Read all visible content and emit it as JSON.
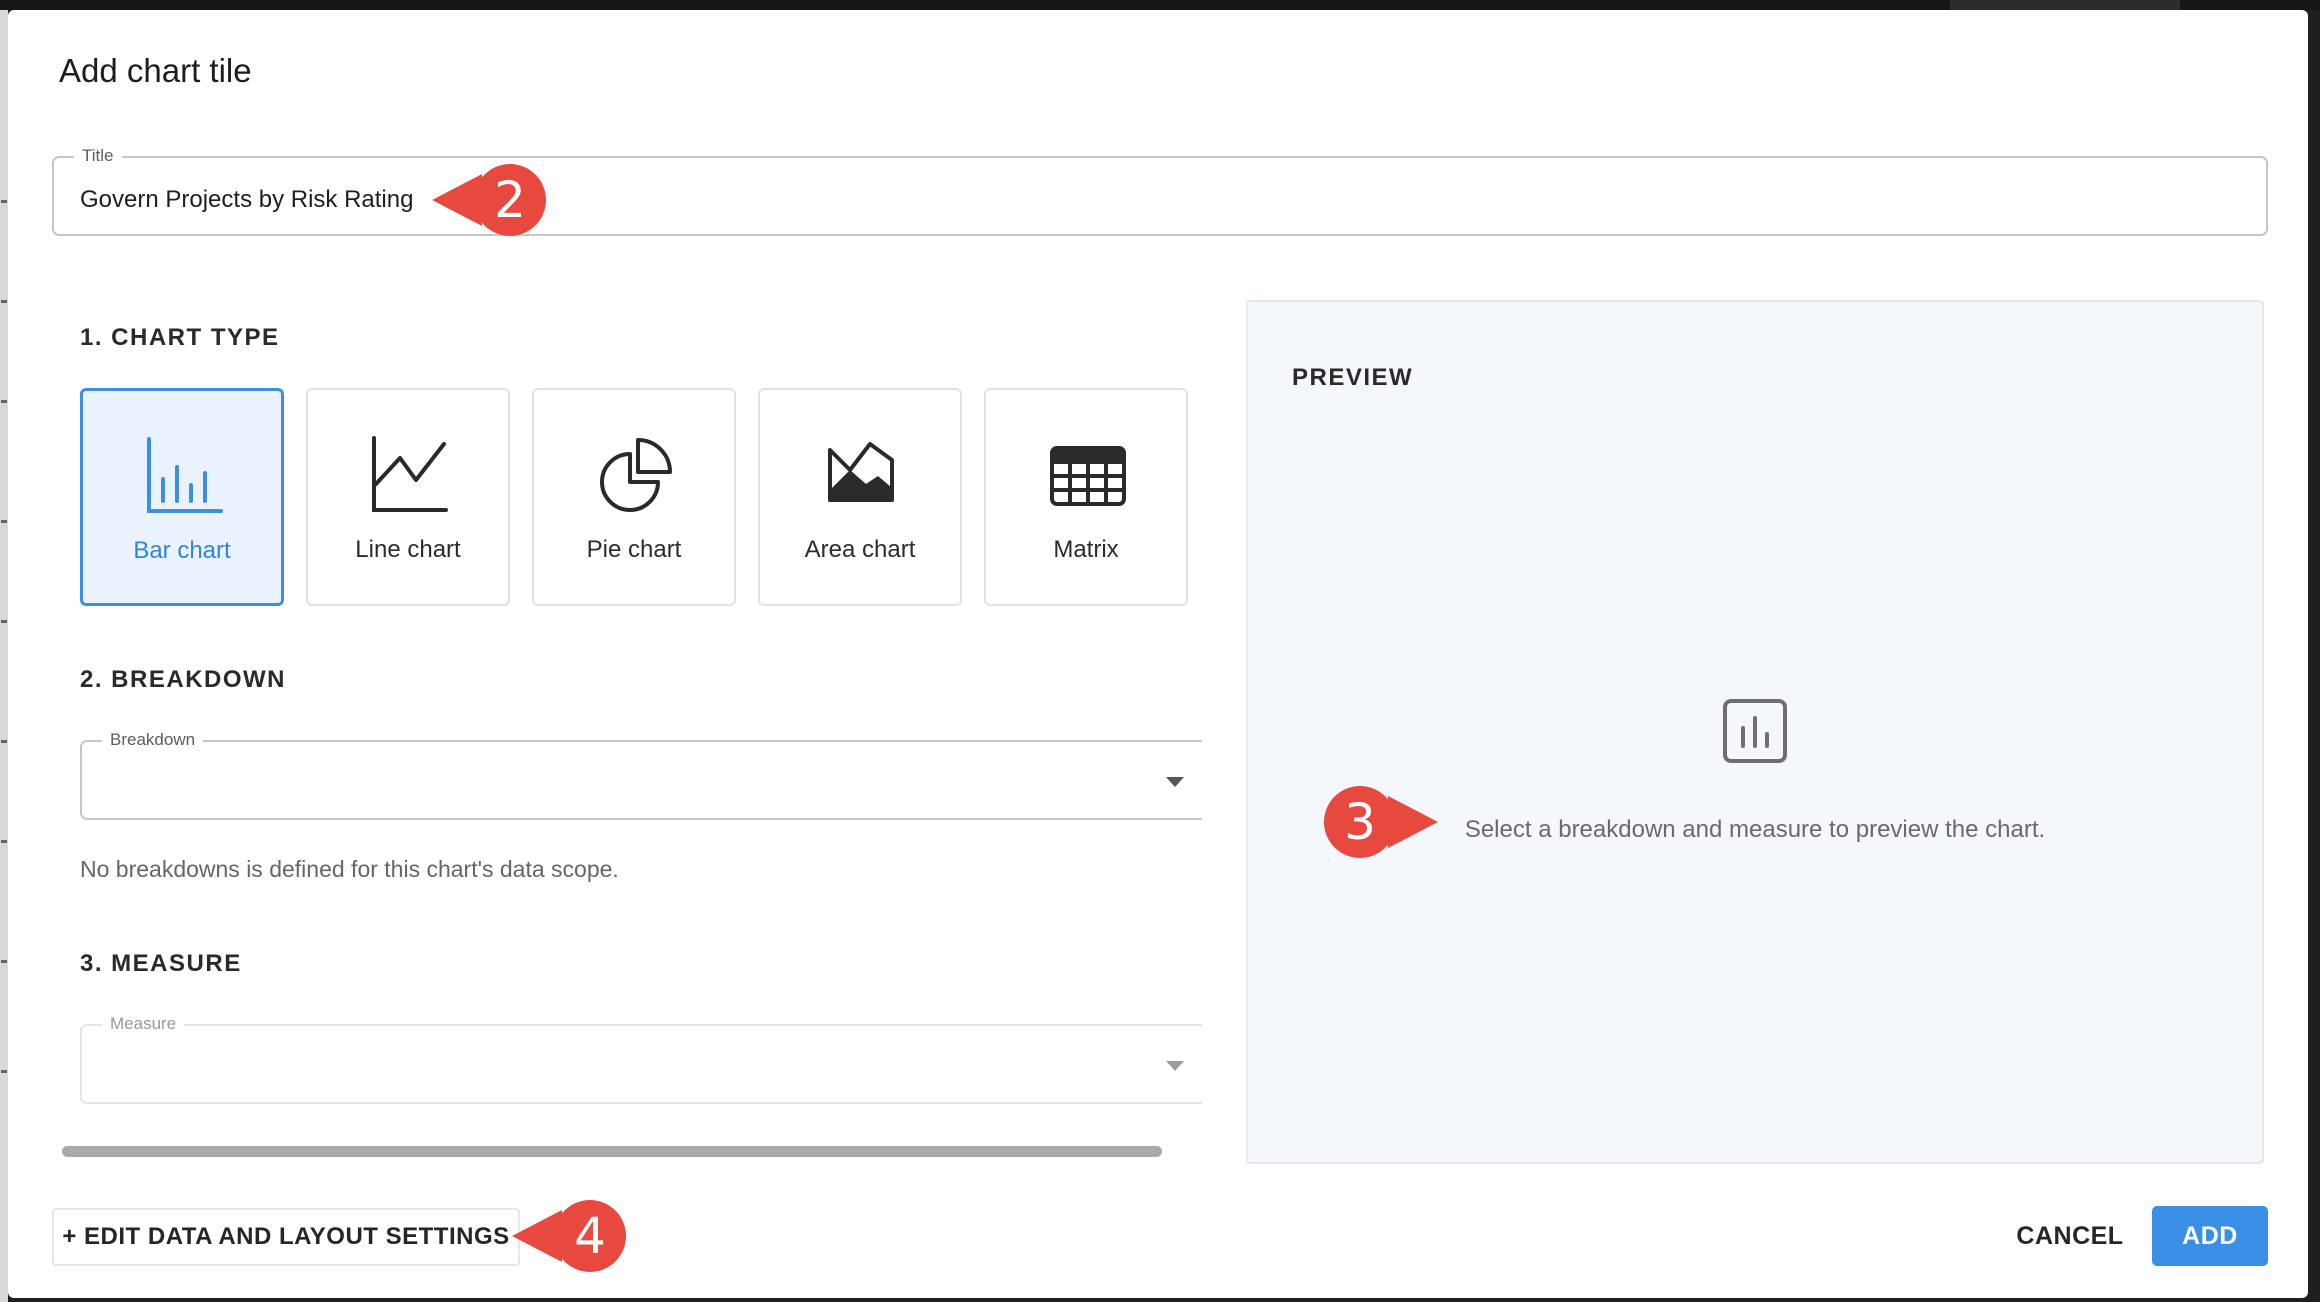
{
  "dialog": {
    "title": "Add chart tile"
  },
  "title_field": {
    "legend": "Title",
    "value": "Govern Projects by Risk Rating"
  },
  "sections": {
    "chart_type": "1. CHART TYPE",
    "breakdown": "2. BREAKDOWN",
    "measure": "3. MEASURE"
  },
  "chart_types": [
    {
      "label": "Bar chart",
      "icon": "bar-chart-icon",
      "selected": true
    },
    {
      "label": "Line chart",
      "icon": "line-chart-icon",
      "selected": false
    },
    {
      "label": "Pie chart",
      "icon": "pie-chart-icon",
      "selected": false
    },
    {
      "label": "Area chart",
      "icon": "area-chart-icon",
      "selected": false
    },
    {
      "label": "Matrix",
      "icon": "matrix-icon",
      "selected": false
    }
  ],
  "breakdown": {
    "legend": "Breakdown",
    "value": "",
    "helper": "No breakdowns is defined for this chart's data scope."
  },
  "measure": {
    "legend": "Measure",
    "value": "",
    "disabled": true
  },
  "preview": {
    "heading": "PREVIEW",
    "icon": "bar-chart-icon",
    "message": "Select a breakdown and measure to preview the chart."
  },
  "footer": {
    "edit_settings_label": "+ EDIT DATA AND LAYOUT SETTINGS",
    "cancel_label": "CANCEL",
    "add_label": "ADD"
  },
  "callouts": [
    "2",
    "3",
    "4"
  ],
  "colors": {
    "accent": "#3a8fe6",
    "callout": "#e8493f",
    "preview_bg": "#f4f7fc"
  }
}
